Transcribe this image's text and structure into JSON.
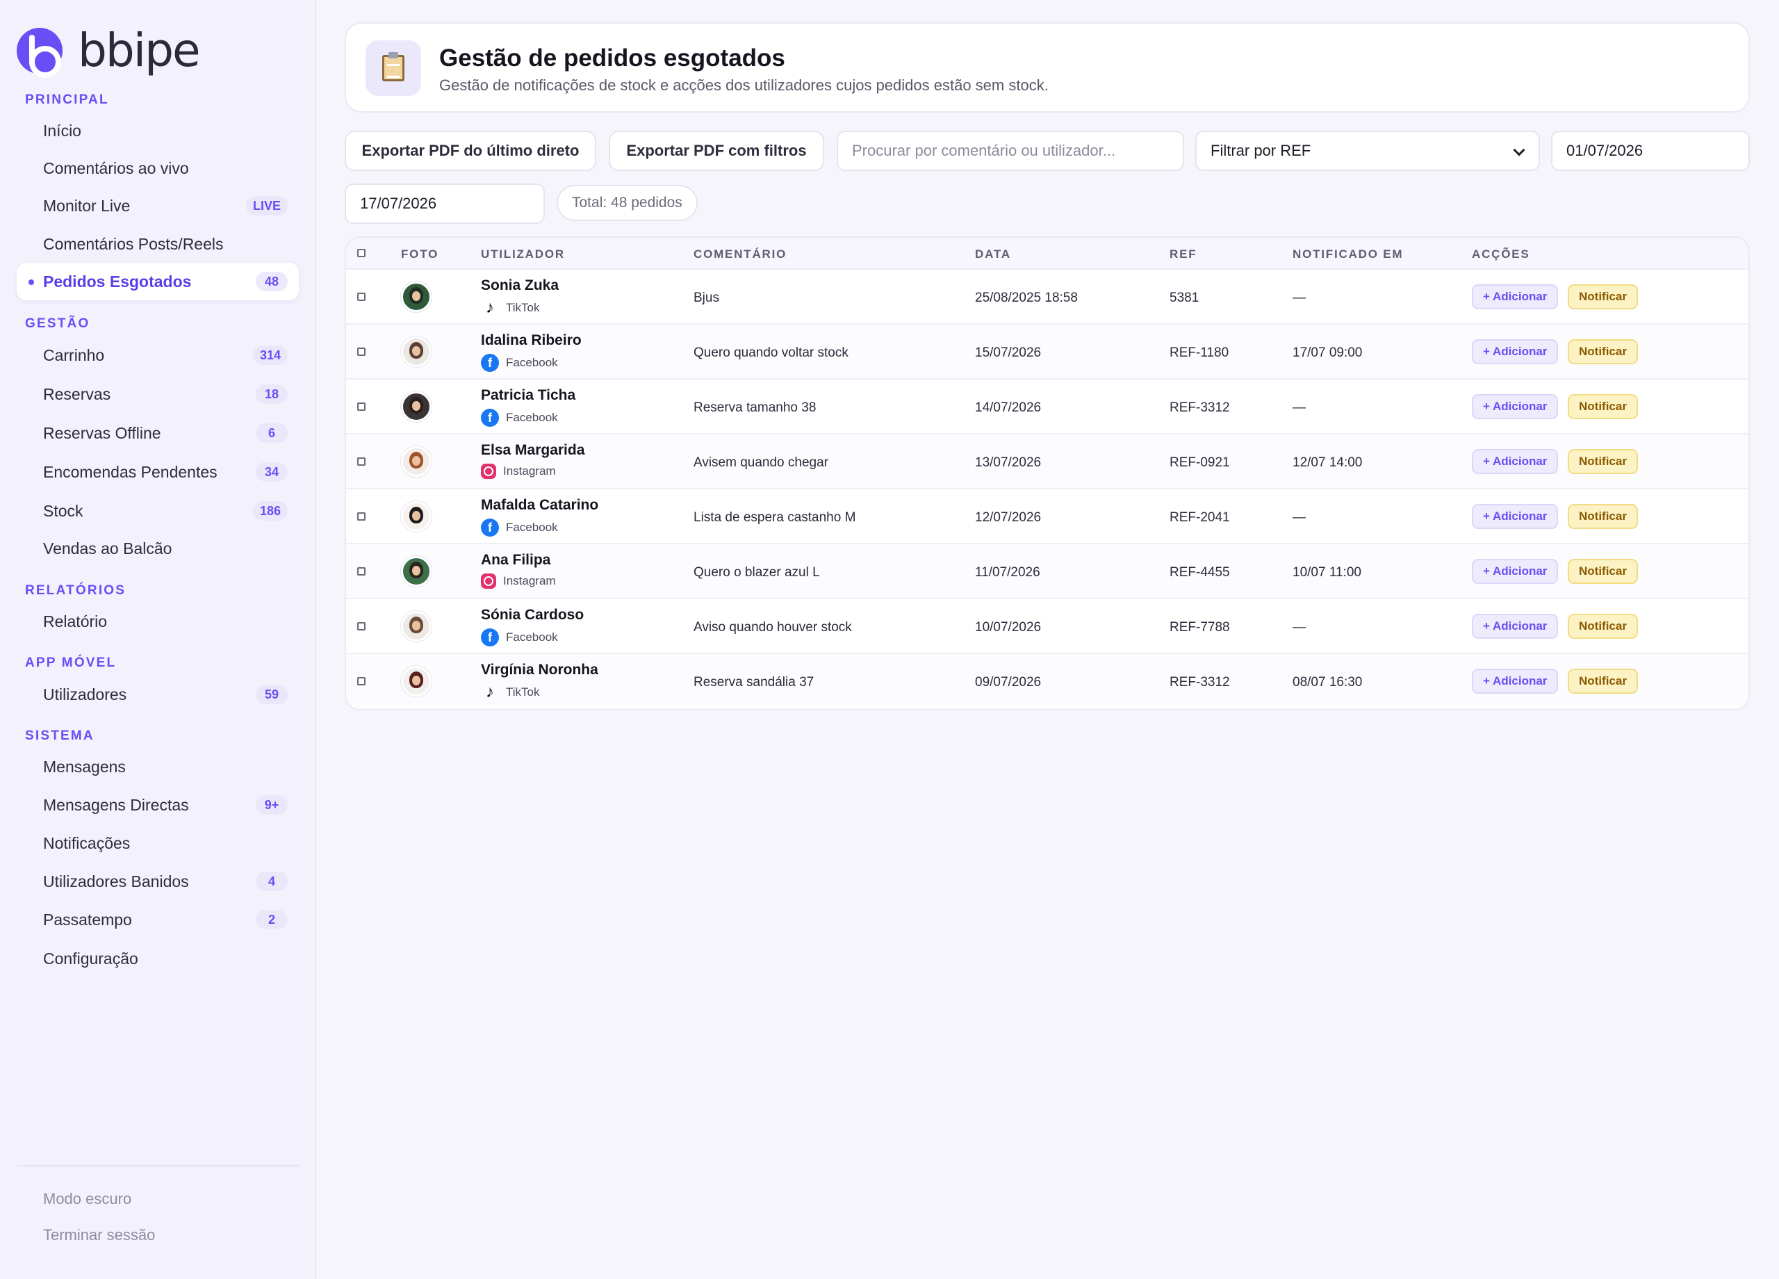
{
  "brand": {
    "name": "bbipe"
  },
  "sidebar": {
    "sections": [
      {
        "label": "PRINCIPAL"
      },
      {
        "label": "GESTÃO"
      },
      {
        "label": "RELATÓRIOS"
      },
      {
        "label": "APP MÓVEL"
      },
      {
        "label": "SISTEMA"
      }
    ],
    "items": [
      {
        "label": "Início",
        "badge": ""
      },
      {
        "label": "Comentários ao vivo",
        "badge": ""
      },
      {
        "label": "Monitor Live",
        "badge": "LIVE"
      },
      {
        "label": "Comentários Posts/Reels",
        "badge": ""
      },
      {
        "label": "Pedidos Esgotados",
        "badge": "48",
        "active": true
      },
      {
        "label": "Carrinho",
        "badge": "314"
      },
      {
        "label": "Reservas",
        "badge": "18"
      },
      {
        "label": "Reservas Offline",
        "badge": "6"
      },
      {
        "label": "Encomendas Pendentes",
        "badge": "34"
      },
      {
        "label": "Stock",
        "badge": "186"
      },
      {
        "label": "Vendas ao Balcão",
        "badge": ""
      },
      {
        "label": "Relatório",
        "badge": ""
      },
      {
        "label": "Utilizadores",
        "badge": "59"
      },
      {
        "label": "Mensagens",
        "badge": ""
      },
      {
        "label": "Mensagens Directas",
        "badge": "9+"
      },
      {
        "label": "Notificações",
        "badge": ""
      },
      {
        "label": "Utilizadores Banidos",
        "badge": "4"
      },
      {
        "label": "Passatempo",
        "badge": "2"
      },
      {
        "label": "Configuração",
        "badge": ""
      }
    ],
    "footer": {
      "dark_mode": "Modo escuro",
      "logout": "Terminar sessão"
    }
  },
  "header": {
    "icon": "clipboard-icon",
    "title": "Gestão de pedidos esgotados",
    "subtitle": "Gestão de notificações de stock e acções dos utilizadores cujos pedidos estão sem stock."
  },
  "toolbar": {
    "export_last_live": "Exportar PDF do último direto",
    "export_filtered": "Exportar PDF com filtros",
    "search_placeholder": "Procurar por comentário ou utilizador...",
    "ref_filter": "Filtrar por REF",
    "date_from": "01/07/2026",
    "date_to": "17/07/2026",
    "total": "Total: 48 pedidos"
  },
  "table": {
    "columns": {
      "foto": "FOTO",
      "utilizador": "UTILIZADOR",
      "comentario": "COMENTÁRIO",
      "data": "DATA",
      "ref": "REF",
      "notificado": "NOTIFICADO EM",
      "accoes": "ACÇÕES"
    },
    "add_label": "+ Adicionar",
    "notify_label": "Notificar",
    "rows": [
      {
        "name": "Sonia Zuka",
        "platform": "TikTok",
        "comment": "Bjus",
        "date": "25/08/2025 18:58",
        "ref": "5381",
        "notified": "—"
      },
      {
        "name": "Idalina Ribeiro",
        "platform": "Facebook",
        "comment": "Quero quando voltar stock",
        "date": "15/07/2026",
        "ref": "REF-1180",
        "notified": "17/07 09:00"
      },
      {
        "name": "Patricia Ticha",
        "platform": "Facebook",
        "comment": "Reserva tamanho 38",
        "date": "14/07/2026",
        "ref": "REF-3312",
        "notified": "—"
      },
      {
        "name": "Elsa Margarida",
        "platform": "Instagram",
        "comment": "Avisem quando chegar",
        "date": "13/07/2026",
        "ref": "REF-0921",
        "notified": "12/07 14:00"
      },
      {
        "name": "Mafalda Catarino",
        "platform": "Facebook",
        "comment": "Lista de espera castanho M",
        "date": "12/07/2026",
        "ref": "REF-2041",
        "notified": "—"
      },
      {
        "name": "Ana Filipa",
        "platform": "Instagram",
        "comment": "Quero o blazer azul L",
        "date": "11/07/2026",
        "ref": "REF-4455",
        "notified": "10/07 11:00"
      },
      {
        "name": "Sónia Cardoso",
        "platform": "Facebook",
        "comment": "Aviso quando houver stock",
        "date": "10/07/2026",
        "ref": "REF-7788",
        "notified": "—"
      },
      {
        "name": "Virgínia Noronha",
        "platform": "TikTok",
        "comment": "Reserva sandália 37",
        "date": "09/07/2026",
        "ref": "REF-3312",
        "notified": "08/07 16:30"
      }
    ]
  },
  "colors": {
    "accent": "#6a4df5",
    "notify_bg": "#fcf2c4",
    "facebook": "#1877f2",
    "instagram": "#e1306c"
  }
}
